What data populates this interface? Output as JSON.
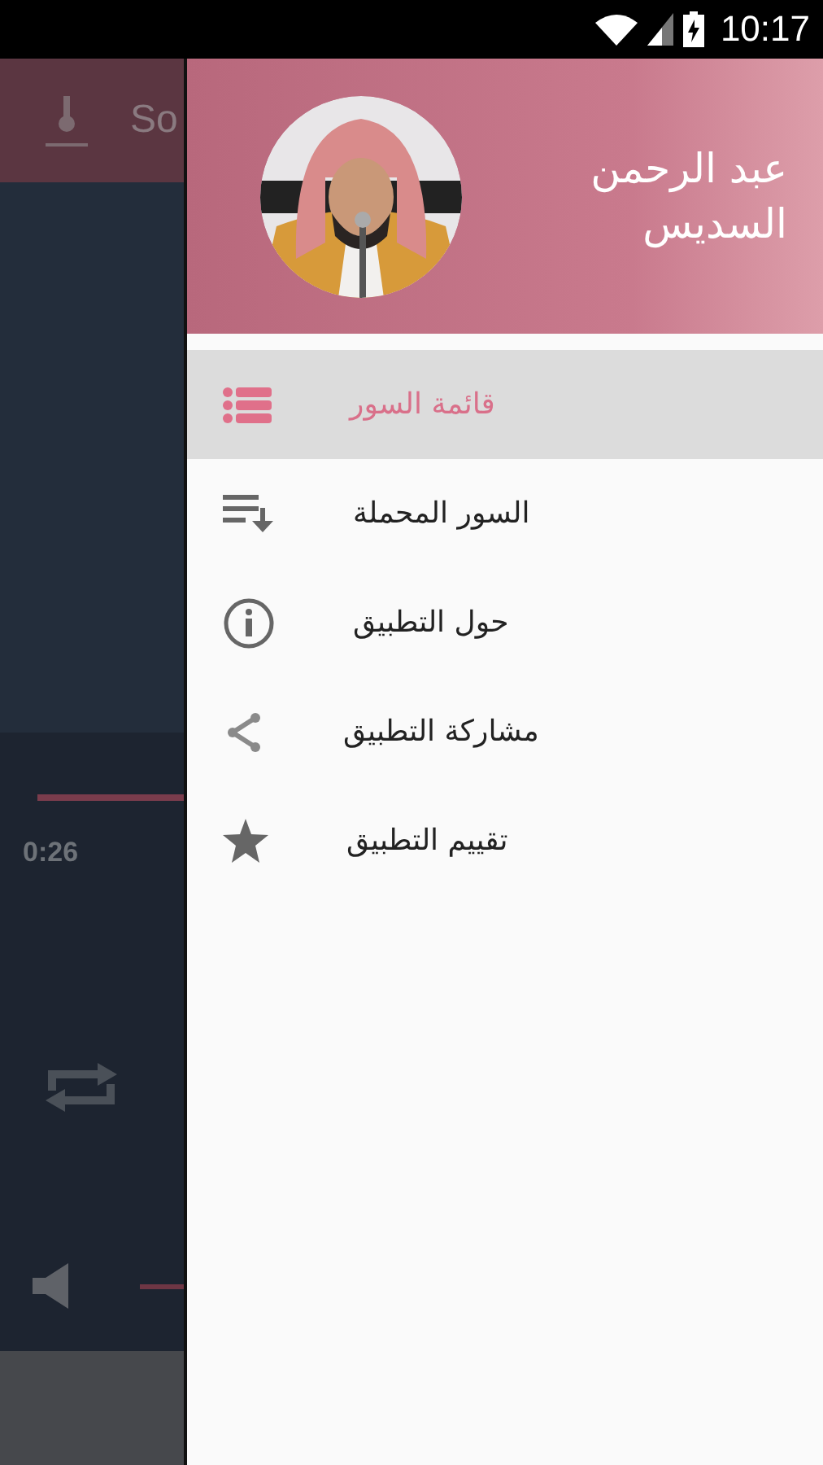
{
  "status_bar": {
    "time": "10:17"
  },
  "background_app": {
    "toolbar_title": "So",
    "elapsed": "0:26"
  },
  "drawer": {
    "header": {
      "name_lines": [
        "عبد الرحمن",
        "السديس"
      ]
    },
    "items": [
      {
        "label": "قائمة السور",
        "selected": true
      },
      {
        "label": "السور المحملة",
        "selected": false
      },
      {
        "label": "حول التطبيق",
        "selected": false
      },
      {
        "label": "مشاركة التطبيق",
        "selected": false
      },
      {
        "label": "تقييم التطبيق",
        "selected": false
      }
    ]
  }
}
